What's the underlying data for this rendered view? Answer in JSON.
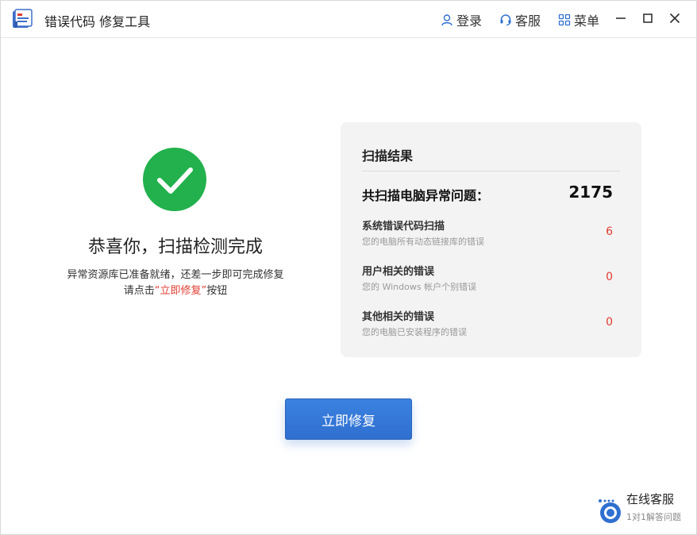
{
  "window": {
    "title": "错误代码 修复工具",
    "actions": {
      "login": "登录",
      "service": "客服",
      "menu": "菜单"
    }
  },
  "status": {
    "title": "恭喜你，扫描检测完成",
    "desc_line1": "异常资源库已准备就绪，还差一步即可完成修复",
    "desc_line2_prefix": "请点击",
    "desc_line2_highlight": "“立即修复”",
    "desc_line2_suffix": "按钮"
  },
  "results": {
    "title": "扫描结果",
    "total_label": "共扫描电脑异常问题：",
    "total_value": "2175",
    "items": [
      {
        "title": "系统错误代码扫描",
        "subtitle": "您的电脑所有动态链接库的错误",
        "count": "6"
      },
      {
        "title": "用户相关的错误",
        "subtitle": "您的 Windows 帐户个别错误",
        "count": "0"
      },
      {
        "title": "其他相关的错误",
        "subtitle": "您的电脑已安装程序的错误",
        "count": "0"
      }
    ]
  },
  "fix_button": "立即修复",
  "online_service": {
    "title": "在线客服",
    "subtitle": "1对1解答问题"
  },
  "colors": {
    "accent_blue": "#2f6fd0",
    "success_green": "#22b14c",
    "highlight_red": "#e03c31"
  }
}
